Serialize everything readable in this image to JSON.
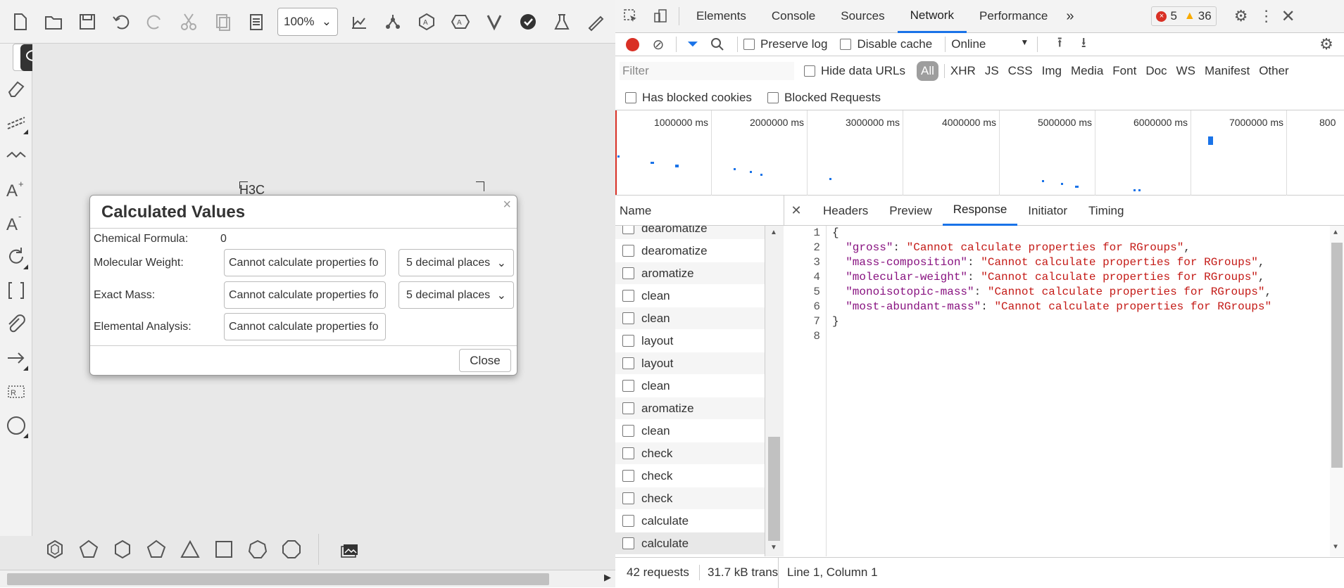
{
  "app": {
    "zoom": "100%",
    "canvas_fragment": "H3C"
  },
  "dialog": {
    "title": "Calculated Values",
    "close_x": "×",
    "rows": {
      "formula_label": "Chemical Formula:",
      "formula_value": "0",
      "mw_label": "Molecular Weight:",
      "mw_value": "Cannot calculate properties fo",
      "mw_decimals": "5 decimal places",
      "em_label": "Exact Mass:",
      "em_value": "Cannot calculate properties fo",
      "em_decimals": "5 decimal places",
      "ea_label": "Elemental Analysis:",
      "ea_value": "Cannot calculate properties fo"
    },
    "close_label": "Close"
  },
  "devtools": {
    "tabs": [
      "Elements",
      "Console",
      "Sources",
      "Network",
      "Performance"
    ],
    "more_tabs": "»",
    "errors": "5",
    "warnings": "36",
    "preserve_log": "Preserve log",
    "disable_cache": "Disable cache",
    "throttle": "Online",
    "filter_placeholder": "Filter",
    "hide_data_urls": "Hide data URLs",
    "types": [
      "All",
      "XHR",
      "JS",
      "CSS",
      "Img",
      "Media",
      "Font",
      "Doc",
      "WS",
      "Manifest",
      "Other"
    ],
    "has_blocked_cookies": "Has blocked cookies",
    "blocked_requests": "Blocked Requests",
    "timeline_ticks": [
      "1000000 ms",
      "2000000 ms",
      "3000000 ms",
      "4000000 ms",
      "5000000 ms",
      "6000000 ms",
      "7000000 ms",
      "800"
    ],
    "name_header": "Name",
    "detail_tabs": [
      "Headers",
      "Preview",
      "Response",
      "Initiator",
      "Timing"
    ],
    "requests": [
      "dearomatize",
      "dearomatize",
      "aromatize",
      "clean",
      "clean",
      "layout",
      "layout",
      "clean",
      "aromatize",
      "clean",
      "check",
      "check",
      "check",
      "calculate",
      "calculate"
    ],
    "response_lines": [
      {
        "n": "1",
        "text": "{"
      },
      {
        "n": "2",
        "key": "\"gross\"",
        "val": "\"Cannot calculate properties for RGroups\"",
        "tail": ","
      },
      {
        "n": "3",
        "key": "\"mass-composition\"",
        "val": "\"Cannot calculate properties for RGroups\"",
        "tail": ","
      },
      {
        "n": "4",
        "key": "\"molecular-weight\"",
        "val": "\"Cannot calculate properties for RGroups\"",
        "tail": ","
      },
      {
        "n": "5",
        "key": "\"monoisotopic-mass\"",
        "val": "\"Cannot calculate properties for RGroups\"",
        "tail": ","
      },
      {
        "n": "6",
        "key": "\"most-abundant-mass\"",
        "val": "\"Cannot calculate properties for RGroups\"",
        "tail": ""
      },
      {
        "n": "7",
        "text": "}"
      },
      {
        "n": "8",
        "text": ""
      }
    ],
    "status_requests": "42 requests",
    "status_transferred": "31.7 kB trans",
    "status_position": "Line 1, Column 1"
  }
}
